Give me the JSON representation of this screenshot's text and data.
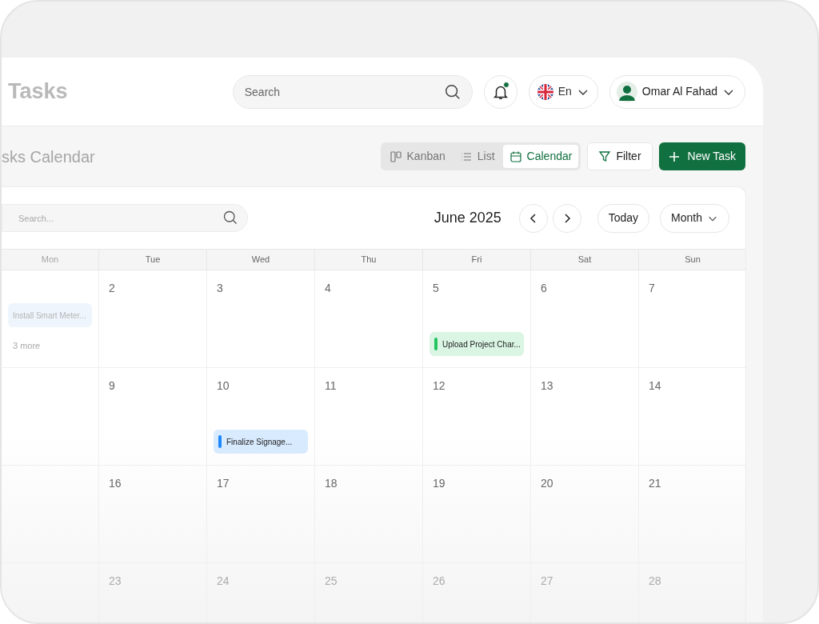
{
  "page": {
    "title": "Tasks"
  },
  "header": {
    "search": {
      "placeholder": "Search"
    },
    "notifications": {
      "unread": true
    },
    "language": {
      "label": "En"
    },
    "user": {
      "name": "Omar Al Fahad"
    }
  },
  "subheader": {
    "title": "sks Calendar",
    "views": [
      {
        "label": "Kanban",
        "kind": "kanban",
        "selected": false
      },
      {
        "label": "List",
        "kind": "list",
        "selected": false
      },
      {
        "label": "Calendar",
        "kind": "calendar",
        "selected": true
      }
    ],
    "filter": "Filter",
    "new_task": "New Task"
  },
  "calendar": {
    "search": {
      "placeholder": "Search..."
    },
    "month": "June 2025",
    "today": "Today",
    "view": "Month",
    "weekdays": [
      "Mon",
      "Tue",
      "Wed",
      "Thu",
      "Fri",
      "Sat",
      "Sun"
    ],
    "weeks": [
      {
        "days": [
          {
            "events": [
              {
                "title": "Install Smart Meter..."
              }
            ],
            "more": "3 more"
          },
          {
            "date": "2"
          },
          {
            "date": "3"
          },
          {
            "date": "4"
          },
          {
            "date": "5",
            "events": [
              {
                "title": "Upload Project Char...",
                "color": "#22c55e"
              }
            ]
          },
          {
            "date": "6"
          },
          {
            "date": "7"
          }
        ]
      },
      {
        "days": [
          {
            "date": "9"
          },
          {
            "date": "10",
            "events": [
              {
                "title": "Finalize Signage...",
                "color": "#1e88ff"
              }
            ]
          },
          {
            "date": "11"
          },
          {
            "date": "12"
          },
          {
            "date": "13"
          },
          {
            "date": "14"
          }
        ]
      },
      {
        "days": [
          {
            "date": "16"
          },
          {
            "date": "17"
          },
          {
            "date": "18"
          },
          {
            "date": "19"
          },
          {
            "date": "20"
          },
          {
            "date": "21"
          }
        ]
      },
      {
        "days": [
          {
            "date": "23"
          },
          {
            "date": "24"
          },
          {
            "date": "25"
          },
          {
            "date": "26"
          },
          {
            "date": "27"
          },
          {
            "date": "28"
          }
        ]
      }
    ]
  }
}
